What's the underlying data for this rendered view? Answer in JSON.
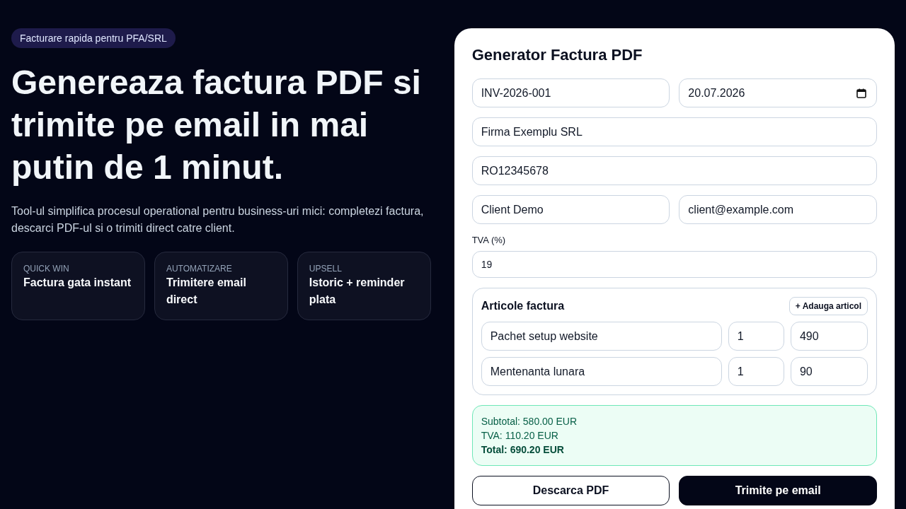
{
  "hero": {
    "badge": "Facturare rapida pentru PFA/SRL",
    "title": "Genereaza factura PDF si trimite pe email in mai putin de 1 minut.",
    "description": "Tool-ul simplifica procesul operational pentru business-uri mici: completezi factura, descarci PDF-ul si o trimiti direct catre client.",
    "highlights": [
      {
        "label": "QUICK WIN",
        "title": "Factura gata instant"
      },
      {
        "label": "AUTOMATIZARE",
        "title": "Trimitere email direct"
      },
      {
        "label": "UPSELL",
        "title": "Istoric + reminder plata"
      }
    ]
  },
  "invoice_form": {
    "title": "Generator Factura PDF",
    "field_rows": [
      [
        {
          "kind": "text",
          "value": "INV-2026-001"
        },
        {
          "kind": "date",
          "value": "20.07.2026"
        }
      ],
      [
        {
          "kind": "text",
          "value": "Firma Exemplu SRL"
        }
      ],
      [
        {
          "kind": "text",
          "value": "RO12345678"
        }
      ],
      [
        {
          "kind": "text",
          "value": "Client Demo"
        },
        {
          "kind": "email",
          "value": "client@example.com"
        }
      ]
    ],
    "vat": {
      "label": "TVA (%)",
      "value": "19"
    },
    "items": {
      "title": "Articole factura",
      "add_button": "+ Adauga articol",
      "rows": [
        {
          "cells": [
            "Pachet setup website",
            "1",
            "490"
          ]
        },
        {
          "cells": [
            "Mentenanta lunara",
            "1",
            "90"
          ]
        }
      ]
    },
    "totals": [
      {
        "kind": "line",
        "text": "Subtotal: 580.00 EUR"
      },
      {
        "kind": "line",
        "text": "TVA: 110.20 EUR"
      },
      {
        "kind": "total",
        "text": "Total: 690.20 EUR"
      }
    ],
    "actions": [
      {
        "kind": "secondary",
        "label": "Descarca PDF"
      },
      {
        "kind": "primary",
        "label": "Trimite pe email"
      }
    ]
  }
}
